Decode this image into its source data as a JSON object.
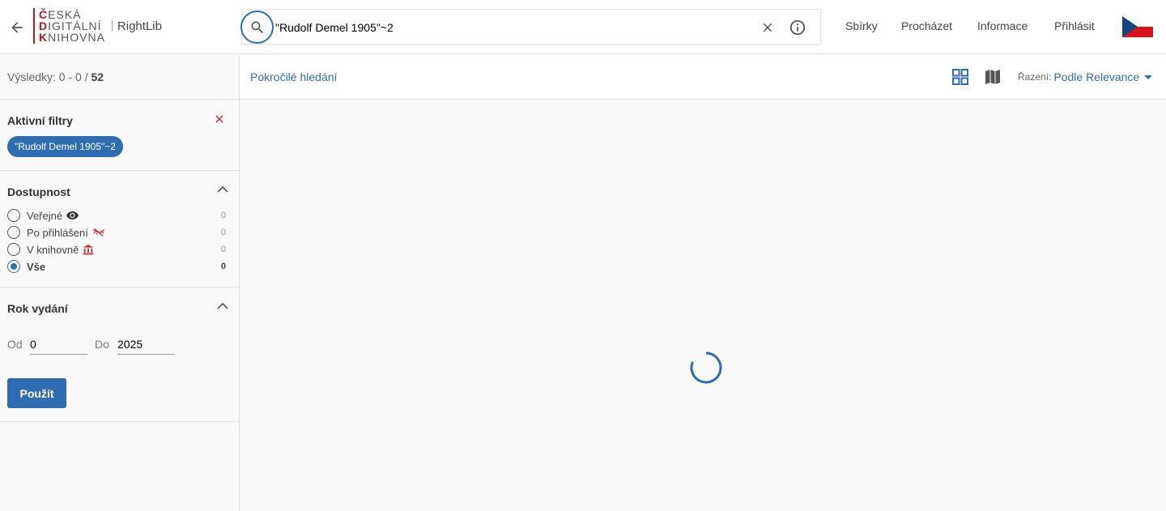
{
  "header": {
    "logo_lines": [
      "ČESKÁ",
      "DIGITÁLNÍ",
      "KNIHOVNA"
    ],
    "logo_sub": "RightLib",
    "search_value": "\"Rudolf Demel 1905\"~2",
    "nav": [
      "Sbírky",
      "Procházet",
      "Informace",
      "Přihlásit"
    ],
    "flag": "czech-flag"
  },
  "sidebar": {
    "results_label": "Výsledky: 0 - 0 / ",
    "results_total": "52",
    "active_filters": {
      "title": "Aktivní filtry",
      "chip": "\"Rudolf Demel 1905\"~2"
    },
    "availability": {
      "title": "Dostupnost",
      "options": [
        {
          "label": "Veřejné",
          "count": "0",
          "icon": "eye-icon",
          "checked": false
        },
        {
          "label": "Po přihlášení",
          "count": "0",
          "icon": "eye-off-icon",
          "checked": false
        },
        {
          "label": "V knihovně",
          "count": "0",
          "icon": "library-icon",
          "checked": false
        },
        {
          "label": "Vše",
          "count": "0",
          "icon": "",
          "checked": true
        }
      ]
    },
    "year": {
      "title": "Rok vydání",
      "from_label": "Od",
      "from_value": "0",
      "to_label": "Do",
      "to_value": "2025",
      "apply_label": "Použít"
    }
  },
  "toolbar": {
    "advanced_search": "Pokročilé hledání",
    "sort_label": "Řazení:",
    "sort_value": "Podle Relevance"
  },
  "colors": {
    "accent": "#2f6db3",
    "brand_red": "#b71c1c"
  }
}
